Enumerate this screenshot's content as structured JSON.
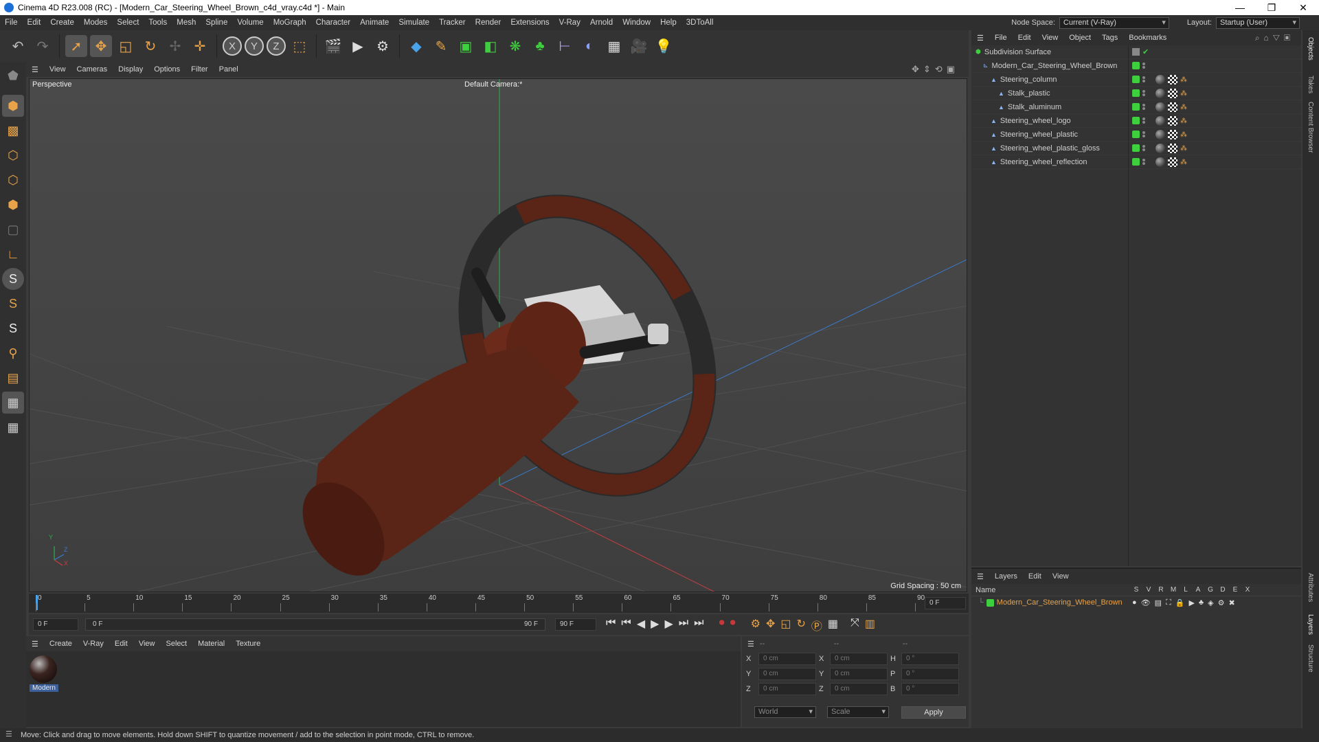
{
  "window": {
    "title": "Cinema 4D R23.008 (RC) - [Modern_Car_Steering_Wheel_Brown_c4d_vray.c4d *] - Main",
    "controls": [
      "—",
      "❐",
      "✕"
    ]
  },
  "menubar": {
    "items": [
      "File",
      "Edit",
      "Create",
      "Modes",
      "Select",
      "Tools",
      "Mesh",
      "Spline",
      "Volume",
      "MoGraph",
      "Character",
      "Animate",
      "Simulate",
      "Tracker",
      "Render",
      "Extensions",
      "V-Ray",
      "Arnold",
      "Window",
      "Help",
      "3DToAll"
    ],
    "node_space_label": "Node Space:",
    "node_space_value": "Current (V-Ray)",
    "layout_label": "Layout:",
    "layout_value": "Startup (User)"
  },
  "viewport": {
    "menu": [
      "View",
      "Cameras",
      "Display",
      "Options",
      "Filter",
      "Panel"
    ],
    "label": "Perspective",
    "camera": "Default Camera",
    "camera_mark": ":*",
    "grid_spacing": "Grid Spacing : 50 cm",
    "axis_y": "Y",
    "axis_z": "Z",
    "axis_x": "X"
  },
  "timeline": {
    "ticks": [
      "0",
      "5",
      "10",
      "15",
      "20",
      "25",
      "30",
      "35",
      "40",
      "45",
      "50",
      "55",
      "60",
      "65",
      "70",
      "75",
      "80",
      "85",
      "90"
    ],
    "current_frame": "0 F"
  },
  "transport": {
    "start": "0 F",
    "range_start": "0 F",
    "range_end": "90 F",
    "end": "90 F"
  },
  "material_manager": {
    "menu": [
      "Create",
      "V-Ray",
      "Edit",
      "View",
      "Select",
      "Material",
      "Texture"
    ],
    "material_name": "Modern"
  },
  "coordinates": {
    "header": [
      "--",
      "--",
      "--"
    ],
    "rows": [
      {
        "a": "X",
        "av": "0 cm",
        "b": "X",
        "bv": "0 cm",
        "c": "H",
        "cv": "0 °"
      },
      {
        "a": "Y",
        "av": "0 cm",
        "b": "Y",
        "bv": "0 cm",
        "c": "P",
        "cv": "0 °"
      },
      {
        "a": "Z",
        "av": "0 cm",
        "b": "Z",
        "bv": "0 cm",
        "c": "B",
        "cv": "0 °"
      }
    ],
    "mode1": "World",
    "mode2": "Scale",
    "apply": "Apply"
  },
  "object_manager": {
    "menu": [
      "File",
      "Edit",
      "View",
      "Object",
      "Tags",
      "Bookmarks"
    ],
    "objects": [
      {
        "name": "Subdivision Surface",
        "level": 0,
        "tags": false,
        "colour": "#cfcfcf"
      },
      {
        "name": "Modern_Car_Steering_Wheel_Brown",
        "level": 1,
        "tags": false,
        "colour": "#cfcfcf"
      },
      {
        "name": "Steering_column",
        "level": 2,
        "tags": true,
        "colour": "#cfcfcf"
      },
      {
        "name": "Stalk_plastic",
        "level": 3,
        "tags": true,
        "colour": "#cfcfcf"
      },
      {
        "name": "Stalk_aluminum",
        "level": 3,
        "tags": true,
        "colour": "#cfcfcf"
      },
      {
        "name": "Steering_wheel_logo",
        "level": 2,
        "tags": true,
        "colour": "#cfcfcf"
      },
      {
        "name": "Steering_wheel_plastic",
        "level": 2,
        "tags": true,
        "colour": "#cfcfcf"
      },
      {
        "name": "Steering_wheel_plastic_gloss",
        "level": 2,
        "tags": true,
        "colour": "#cfcfcf"
      },
      {
        "name": "Steering_wheel_reflection",
        "level": 2,
        "tags": true,
        "colour": "#cfcfcf"
      }
    ]
  },
  "layer_manager": {
    "menu": [
      "Layers",
      "Edit",
      "View"
    ],
    "columns_name": "Name",
    "columns": [
      "S",
      "V",
      "R",
      "M",
      "L",
      "A",
      "G",
      "D",
      "E",
      "X"
    ],
    "layer_name": "Modern_Car_Steering_Wheel_Brown",
    "layer_colour": "#e8a34a"
  },
  "right_tabs": [
    "Objects",
    "Takes",
    "Content Browser",
    "Attributes",
    "Layers",
    "Structure"
  ],
  "status": "Move: Click and drag to move elements. Hold down SHIFT to quantize movement / add to the selection in point mode, CTRL to remove."
}
